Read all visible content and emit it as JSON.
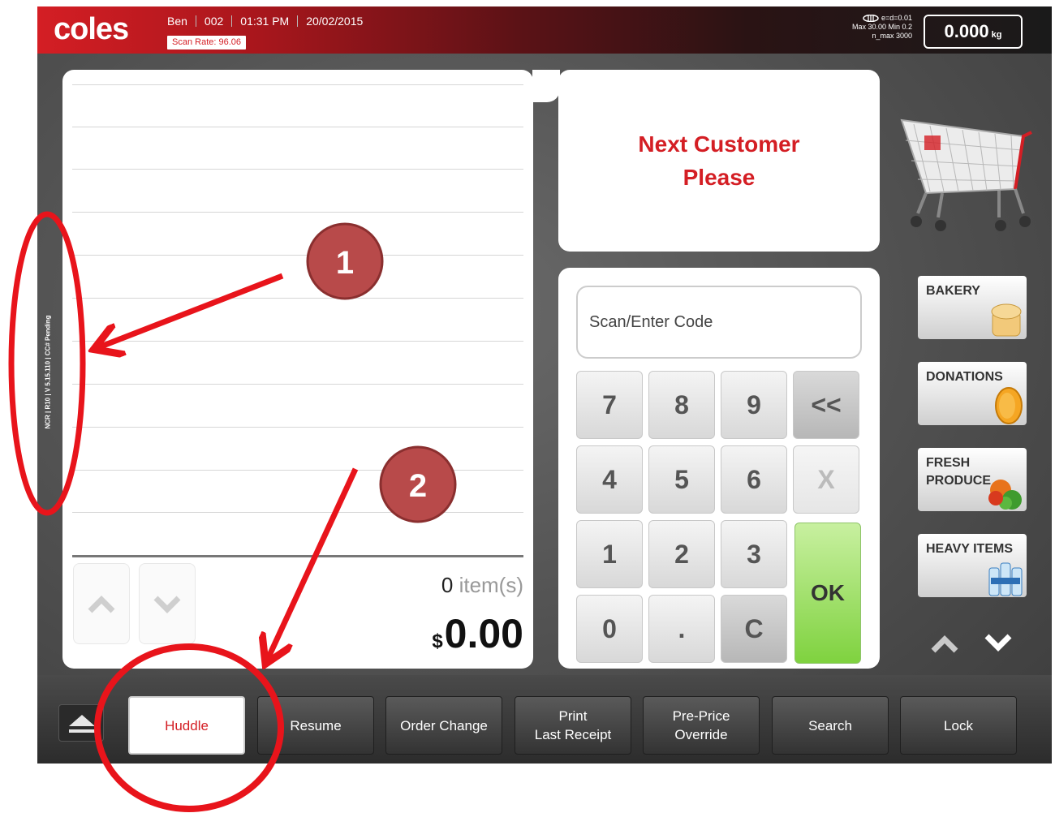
{
  "brand": {
    "logo": "coles",
    "accent": "#d41e24"
  },
  "header": {
    "operator": "Ben",
    "lane": "002",
    "time": "01:31 PM",
    "date": "20/02/2015",
    "scan_rate": "Scan Rate: 96.06",
    "scale_spec_line1": "e=d=0.01",
    "scale_spec_line2": "Max 30.00 Min 0.2",
    "scale_spec_line3": "n_max 3000",
    "weight": "0.000",
    "weight_unit": "kg"
  },
  "side_label": "NCR | R10 | V 5.15.110 | CC# Pending",
  "receipt": {
    "item_count": "0",
    "item_label": "item(s)",
    "currency": "$",
    "total": "0.00",
    "up_icon": "chevron-up-icon",
    "down_icon": "chevron-down-icon"
  },
  "message": {
    "line1": "Next Customer",
    "line2": "Please"
  },
  "keypad": {
    "placeholder": "Scan/Enter Code",
    "keys": [
      "7",
      "8",
      "9",
      "<<",
      "4",
      "5",
      "6",
      "X",
      "1",
      "2",
      "3",
      "0",
      ".",
      "C"
    ],
    "ok": "OK"
  },
  "categories": [
    {
      "label": "BAKERY",
      "icon": "bread-icon"
    },
    {
      "label": "DONATIONS",
      "icon": "coin-icon"
    },
    {
      "label": "FRESH\nPRODUCE",
      "icon": "produce-icon"
    },
    {
      "label": "HEAVY ITEMS",
      "icon": "water-bottles-icon"
    }
  ],
  "function_bar": {
    "eject_icon": "eject-icon",
    "buttons": [
      "Huddle",
      "Resume",
      "Order Change",
      "Print\nLast Receipt",
      "Pre-Price\nOverride",
      "Search",
      "Lock"
    ],
    "active": "Huddle"
  },
  "annotations": {
    "badge1": "1",
    "badge2": "2",
    "color": "#e8141b",
    "badge_fill": "#b84a4a"
  }
}
